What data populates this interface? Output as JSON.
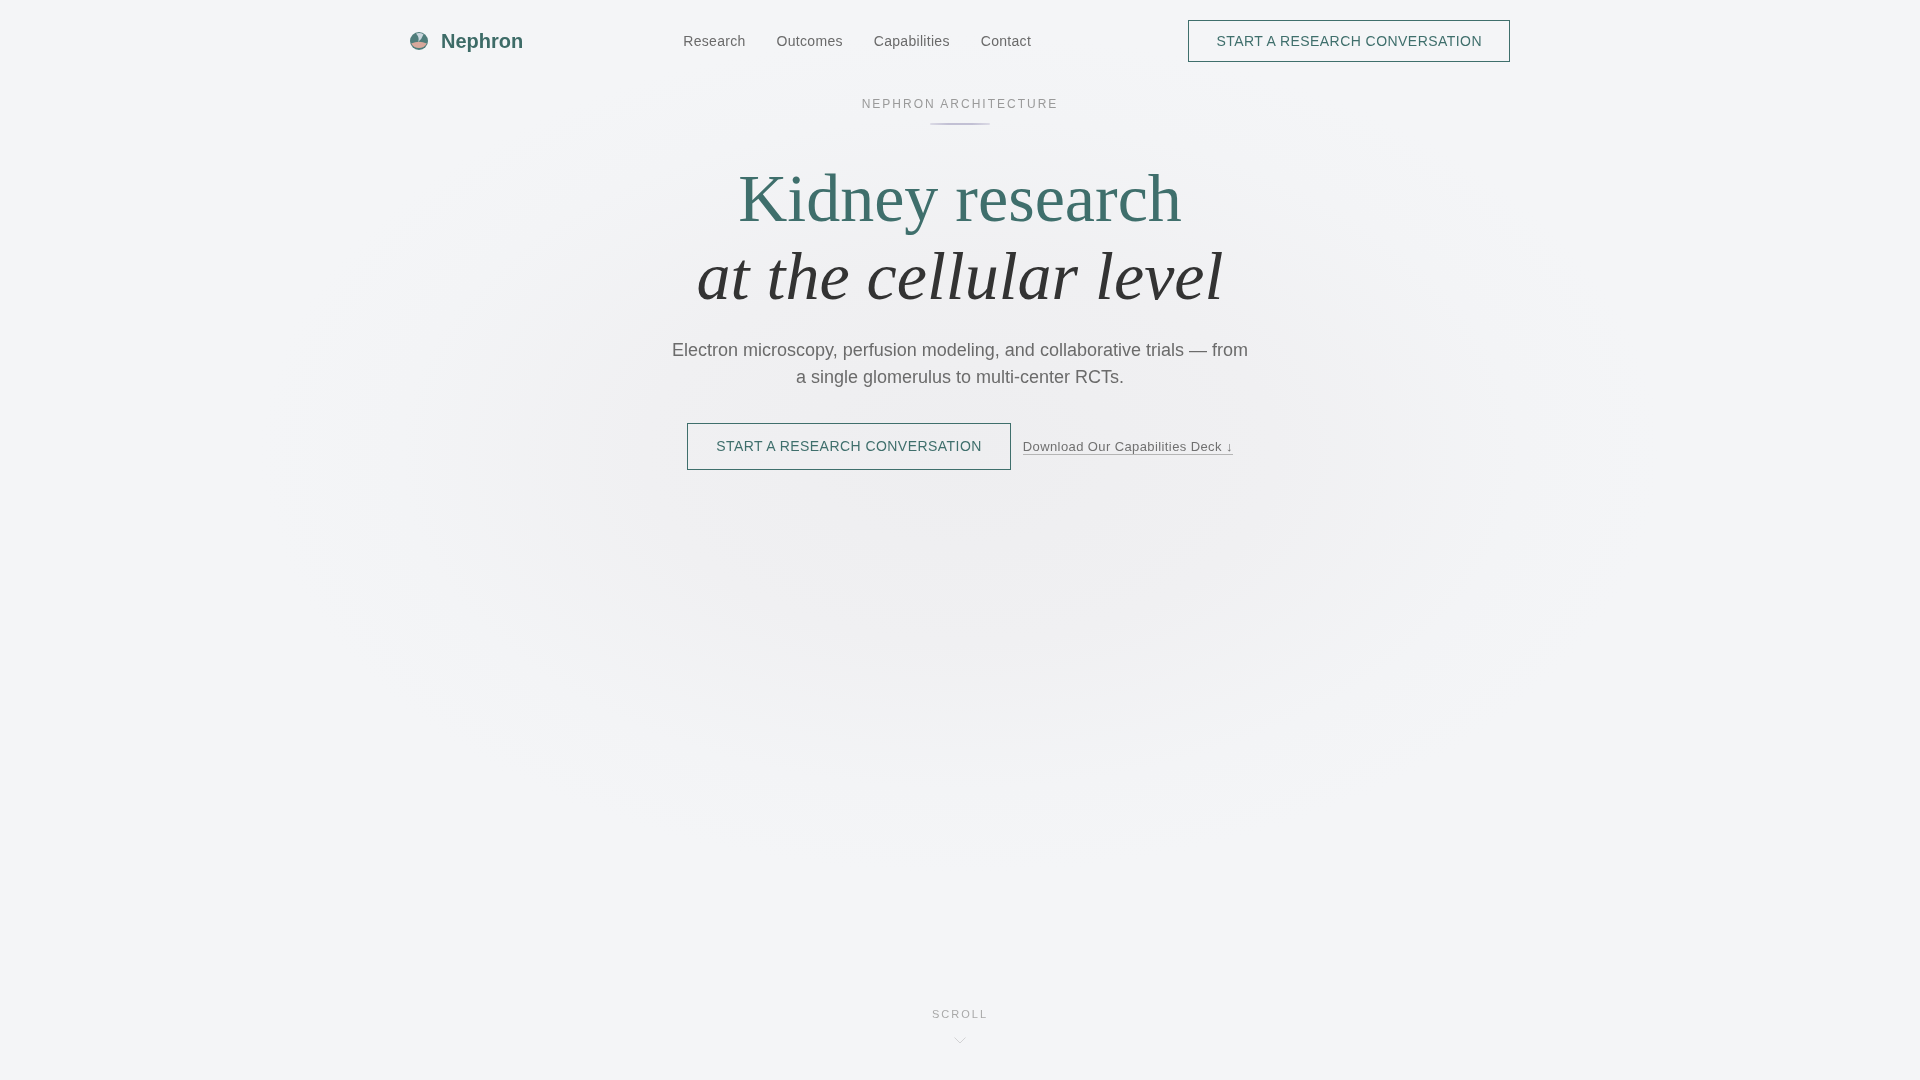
{
  "header": {
    "logo": {
      "name": "Nephron"
    },
    "nav": [
      "Research",
      "Outcomes",
      "Capabilities",
      "Contact"
    ],
    "cta_button": "START A RESEARCH CONVERSATION"
  },
  "hero": {
    "eyebrow": "NEPHRON ARCHITECTURE",
    "headline": "Kidney research",
    "headline_italic": "at the cellular level",
    "description": "Electron microscopy, perfusion modeling, and collaborative trials — from a single glomerulus to multi-center RCTs.",
    "primary_button": "START A RESEARCH CONVERSATION",
    "secondary_link": "Download Our Capabilities Deck ↓"
  },
  "scroll_hint": {
    "label": "SCROLL"
  }
}
